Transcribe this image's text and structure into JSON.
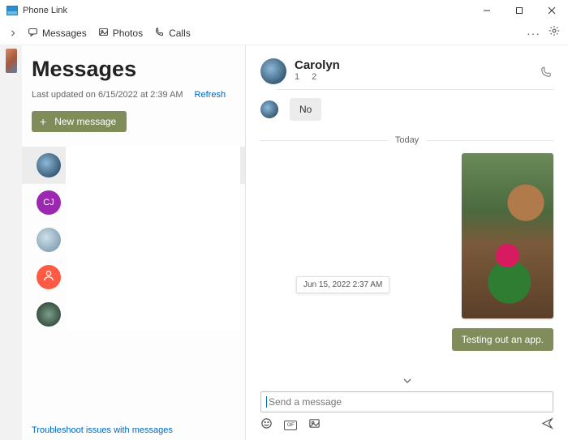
{
  "app": {
    "title": "Phone Link"
  },
  "window_controls": {
    "min": "minimize",
    "max": "maximize",
    "close": "close"
  },
  "nav": {
    "messages": "Messages",
    "photos": "Photos",
    "calls": "Calls"
  },
  "sidebar": {
    "title": "Messages",
    "last_updated": "Last updated on 6/15/2022 at 2:39 AM",
    "refresh": "Refresh",
    "new_message": "New message",
    "troubleshoot": "Troubleshoot issues with messages",
    "threads": [
      {
        "initials": "",
        "avatar": "av1",
        "selected": true
      },
      {
        "initials": "CJ",
        "avatar": "av2"
      },
      {
        "initials": "",
        "avatar": "av3"
      },
      {
        "initials": "",
        "avatar": "av4"
      },
      {
        "initials": "",
        "avatar": "av5"
      }
    ]
  },
  "conversation": {
    "contact_name": "Carolyn",
    "contact_phone_masked": "1            2",
    "incoming": {
      "text": "No"
    },
    "divider_label": "Today",
    "timestamp_popup": "Jun 15, 2022 2:37 AM",
    "outgoing": {
      "text": "Testing out an app."
    },
    "compose_placeholder": "Send a message"
  }
}
